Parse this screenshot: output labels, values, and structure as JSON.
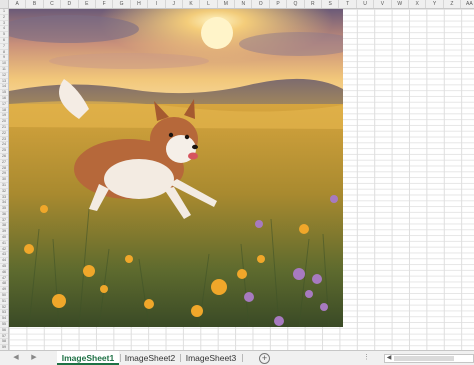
{
  "spreadsheet": {
    "columns": [
      "A",
      "B",
      "C",
      "D",
      "E",
      "F",
      "G",
      "H",
      "I",
      "J",
      "K",
      "L",
      "M",
      "N",
      "O",
      "P",
      "Q",
      "R",
      "S",
      "T",
      "U",
      "V",
      "W",
      "X",
      "Y",
      "Z",
      "AA"
    ],
    "rows": [
      "1",
      "2",
      "3",
      "4",
      "5",
      "6",
      "7",
      "8",
      "9",
      "10",
      "11",
      "12",
      "13",
      "14",
      "15",
      "16",
      "17",
      "18",
      "19",
      "20",
      "21",
      "22",
      "23",
      "24",
      "25",
      "26",
      "27",
      "28",
      "29",
      "30",
      "31",
      "32",
      "33",
      "34",
      "35",
      "36",
      "37",
      "38",
      "39",
      "40",
      "41",
      "42",
      "43",
      "44",
      "45",
      "46",
      "47",
      "48",
      "49",
      "50",
      "51",
      "52",
      "53",
      "54",
      "55",
      "56",
      "57",
      "58",
      "59"
    ]
  },
  "image": {
    "subject": "painting of a small dog running through a golden meadow at sunset"
  },
  "sheet_tabs": {
    "tabs": [
      {
        "label": "ImageSheet1",
        "active": true
      },
      {
        "label": "ImageSheet2",
        "active": false
      },
      {
        "label": "ImageSheet3",
        "active": false
      }
    ],
    "add_sheet_symbol": "+",
    "more_symbol": "⋮",
    "scroll_left_symbol": "◀",
    "scroll_right_symbol": "▶",
    "hscroll_left_symbol": "◀"
  },
  "colors": {
    "active_tab_accent": "#1e7145"
  }
}
